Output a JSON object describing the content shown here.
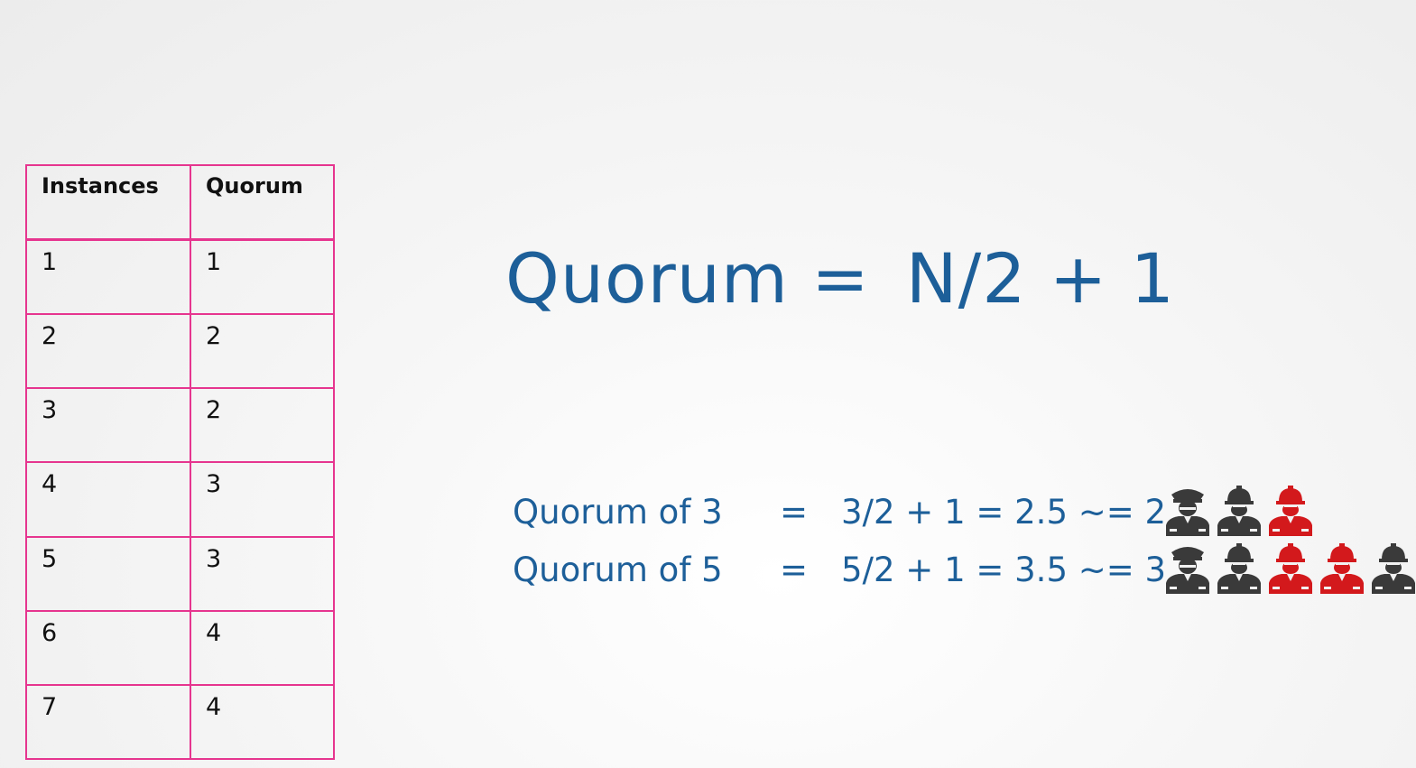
{
  "table": {
    "headers": [
      "Instances",
      "Quorum"
    ],
    "rows": [
      [
        "1",
        "1"
      ],
      [
        "2",
        "2"
      ],
      [
        "3",
        "2"
      ],
      [
        "4",
        "3"
      ],
      [
        "5",
        "3"
      ],
      [
        "6",
        "4"
      ],
      [
        "7",
        "4"
      ]
    ]
  },
  "formula": {
    "left": "Quorum =",
    "right": "N/2 + 1"
  },
  "examples": [
    {
      "label": "Quorum of 3",
      "equals": "=",
      "calc": "3/2 + 1 = 2.5 ~= 2",
      "icons": [
        {
          "name": "officer-icon",
          "color": "#3a3a3a"
        },
        {
          "name": "worker-icon",
          "color": "#3a3a3a"
        },
        {
          "name": "worker-icon",
          "color": "#d3191c"
        }
      ]
    },
    {
      "label": "Quorum of 5",
      "equals": "=",
      "calc": "5/2 + 1 = 3.5 ~= 3",
      "icons": [
        {
          "name": "officer-icon",
          "color": "#3a3a3a"
        },
        {
          "name": "worker-icon",
          "color": "#3a3a3a"
        },
        {
          "name": "worker-icon",
          "color": "#d3191c"
        },
        {
          "name": "worker-icon",
          "color": "#d3191c"
        },
        {
          "name": "worker-icon",
          "color": "#3a3a3a"
        }
      ]
    }
  ],
  "colors": {
    "accent_text": "#1d5f99",
    "table_border": "#e6358f"
  }
}
